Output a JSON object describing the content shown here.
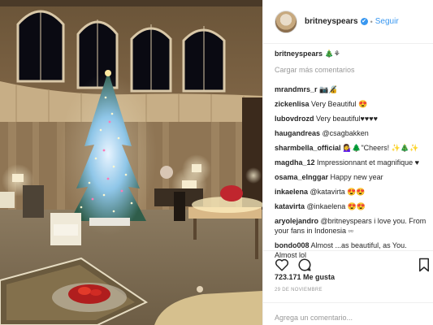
{
  "post": {
    "username": "britneyspears",
    "verified_mark": "✔",
    "separator": "•",
    "follow_label": "Seguir",
    "caption_user": "britneyspears",
    "caption_text": "🎄⚘",
    "load_more": "Cargar más comentarios",
    "likes": "723.171 Me gusta",
    "date": "29 DE NOVIEMBRE",
    "add_comment_placeholder": "Agrega un comentario..."
  },
  "comments": [
    {
      "user": "mrandmrs_r",
      "text": "📷🔏"
    },
    {
      "user": "zickenlisa",
      "text": "Very Beautiful 😍"
    },
    {
      "user": "lubovdrozd",
      "text": "Very beautiful♥♥♥♥"
    },
    {
      "user": "haugandreas",
      "text": "@csagbakken"
    },
    {
      "user": "sharmbella_official",
      "text": "💁‍♀️🌲\"Cheers! ✨🎄✨"
    },
    {
      "user": "magdha_12",
      "text": "Impressionnant et magnifique ♥"
    },
    {
      "user": "osama_elnggar",
      "text": "Happy new year"
    },
    {
      "user": "inkaelena",
      "text": "@katavirta 😍😍"
    },
    {
      "user": "katavirta",
      "text": "@inkaelena 😍😍"
    },
    {
      "user": "aryolejandro",
      "text": "@britneyspears i love you. From your fans in Indonesia ▫▫"
    },
    {
      "user": "bondo008",
      "text": "Almost ...as beautiful, as You. Almost lol"
    }
  ],
  "icons": {
    "like": "heart-icon",
    "comment": "comment-icon",
    "save": "bookmark-icon"
  },
  "colors": {
    "accent": "#3897f0",
    "muted": "#999999",
    "text": "#262626"
  }
}
